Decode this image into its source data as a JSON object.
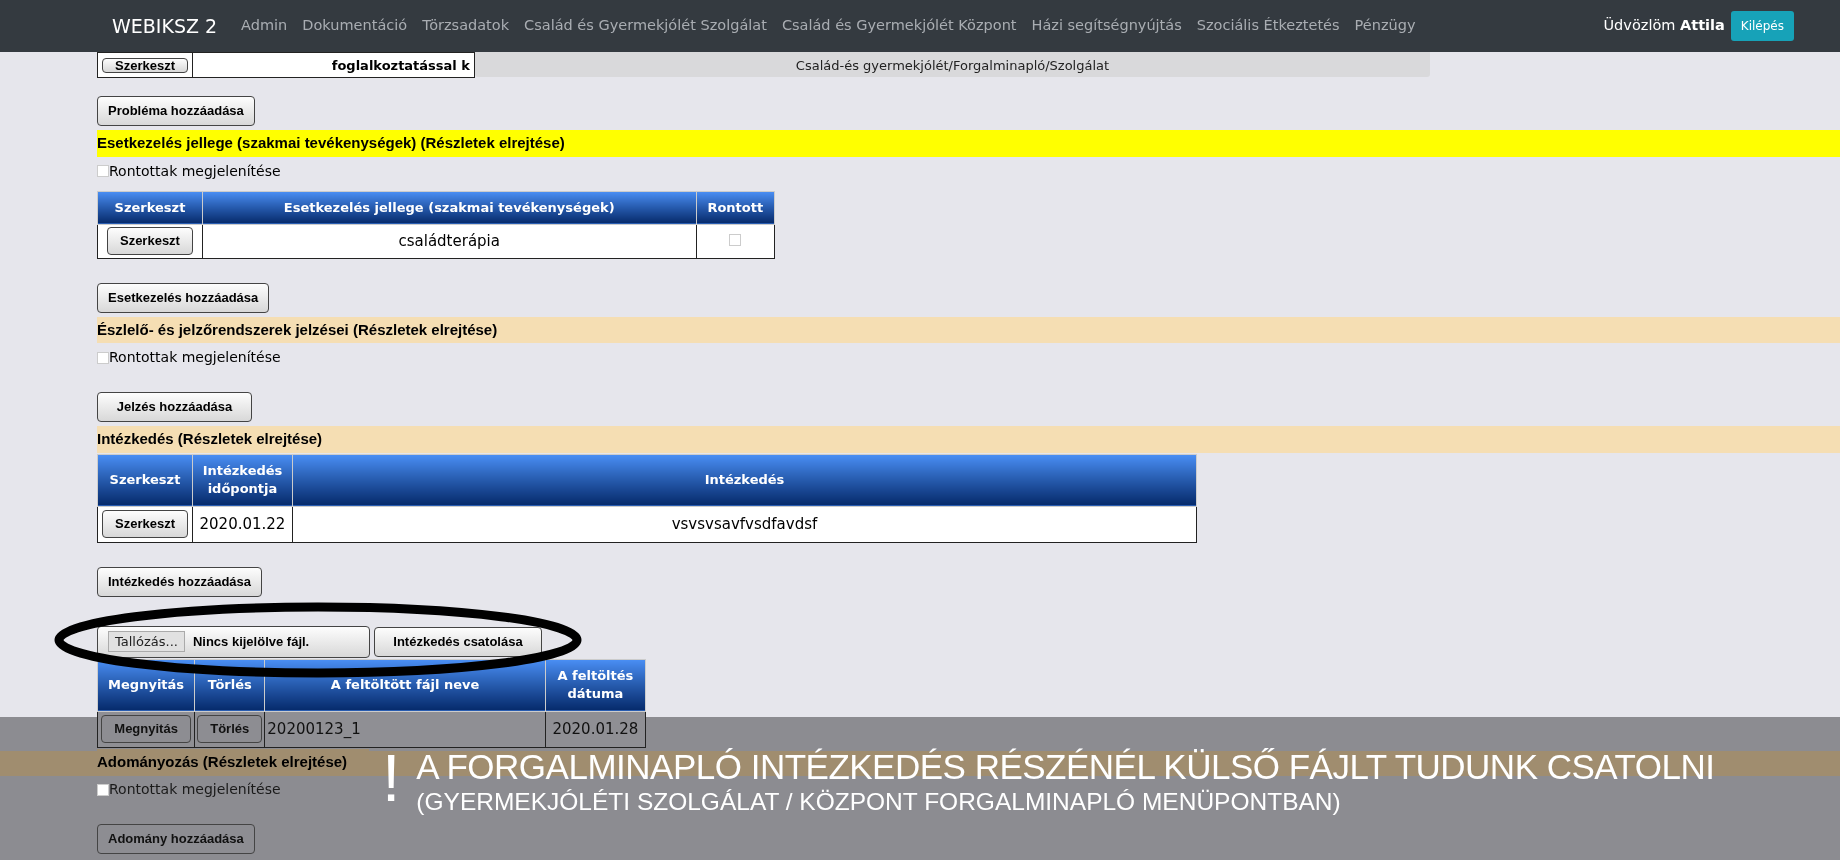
{
  "nav": {
    "brand": "WEBIKSZ 2",
    "items": [
      "Admin",
      "Dokumentáció",
      "Törzsadatok",
      "Család és Gyermekjólét Szolgálat",
      "Család és Gyermekjólét Központ",
      "Házi segítségnyújtás",
      "Szociális Étkeztetés",
      "Pénzügy"
    ],
    "greeting": "Üdvözlöm",
    "user": "Attila",
    "logout": "Kilépés"
  },
  "breadcrumb": "Család-és gyermekjólét/Forgalminapló/Szolgálat",
  "top_row": {
    "button": "Szerkeszt",
    "text": "foglalkoztatással k"
  },
  "blocks": [
    {
      "kind": "button",
      "text": "Probléma hozzáadása"
    },
    {
      "kind": "header",
      "text": "Esetkezelés jellege (szakmai tevékenységek) (Részletek elrejtése)",
      "color": "#ffff00"
    },
    {
      "kind": "checkbox",
      "label": "Rontottak megjelenítése",
      "checked": false
    },
    {
      "kind": "table",
      "columns": [
        "Szerkeszt",
        "Esetkezelés jellege (szakmai tevékenységek)",
        "Rontott"
      ],
      "rows": [
        [
          {
            "kind": "button",
            "text": "Szerkeszt"
          },
          {
            "kind": "text",
            "text": "családterápia"
          },
          {
            "kind": "checkbox",
            "checked": false
          }
        ]
      ]
    },
    {
      "kind": "button",
      "text": "Esetkezelés hozzáadása"
    },
    {
      "kind": "header",
      "text": "Észlelő- és jelzőrendszerek jelzései (Részletek elrejtése)",
      "color": "#f5deb3"
    },
    {
      "kind": "checkbox",
      "label": "Rontottak megjelenítése",
      "checked": false
    },
    {
      "kind": "button",
      "text": "Jelzés hozzáadása"
    },
    {
      "kind": "header",
      "text": "Intézkedés (Részletek elrejtése)",
      "color": "#f5deb3"
    },
    {
      "kind": "table",
      "columns": [
        "Szerkeszt",
        "Intézkedés időpontja",
        "Intézkedés"
      ],
      "rows": [
        [
          {
            "kind": "button",
            "text": "Szerkeszt"
          },
          {
            "kind": "text",
            "text": "2020.01.22"
          },
          {
            "kind": "text",
            "text": "vsvsvsavfvsdfavdsf"
          }
        ]
      ]
    },
    {
      "kind": "button",
      "text": "Intézkedés hozzáadása"
    },
    {
      "kind": "upload",
      "browse": "Tallózás...",
      "status": "Nincs kijelölve fájl.",
      "attach": "Intézkedés csatolása"
    },
    {
      "kind": "table",
      "columns": [
        "Megnyitás",
        "Törlés",
        "A feltöltött fájl neve",
        "A feltöltés dátuma"
      ],
      "rows": [
        [
          {
            "kind": "button",
            "text": "Megnyitás"
          },
          {
            "kind": "button",
            "text": "Törlés"
          },
          {
            "kind": "text",
            "text": "20200123_1"
          },
          {
            "kind": "text",
            "text": "2020.01.28"
          }
        ]
      ],
      "shaded": true
    },
    {
      "kind": "header",
      "text": "Adományozás (Részletek elrejtése)",
      "color": "#a08d6f"
    },
    {
      "kind": "checkbox",
      "label": "Rontottak megjelenítése",
      "checked": false,
      "shaded": true
    },
    {
      "kind": "button",
      "text": "Adomány hozzáadása",
      "shaded": true
    }
  ],
  "caption": {
    "mark": "!",
    "title": "A FORGALMINAPLÓ INTÉZKEDÉS RÉSZÉNÉL KÜLSŐ FÁJLT TUDUNK CSATOLNI",
    "subtitle": "(GYERMEKJÓLÉTI SZOLGÁLAT / KÖZPONT FORGALMINAPLÓ MENÜPONTBAN)"
  }
}
